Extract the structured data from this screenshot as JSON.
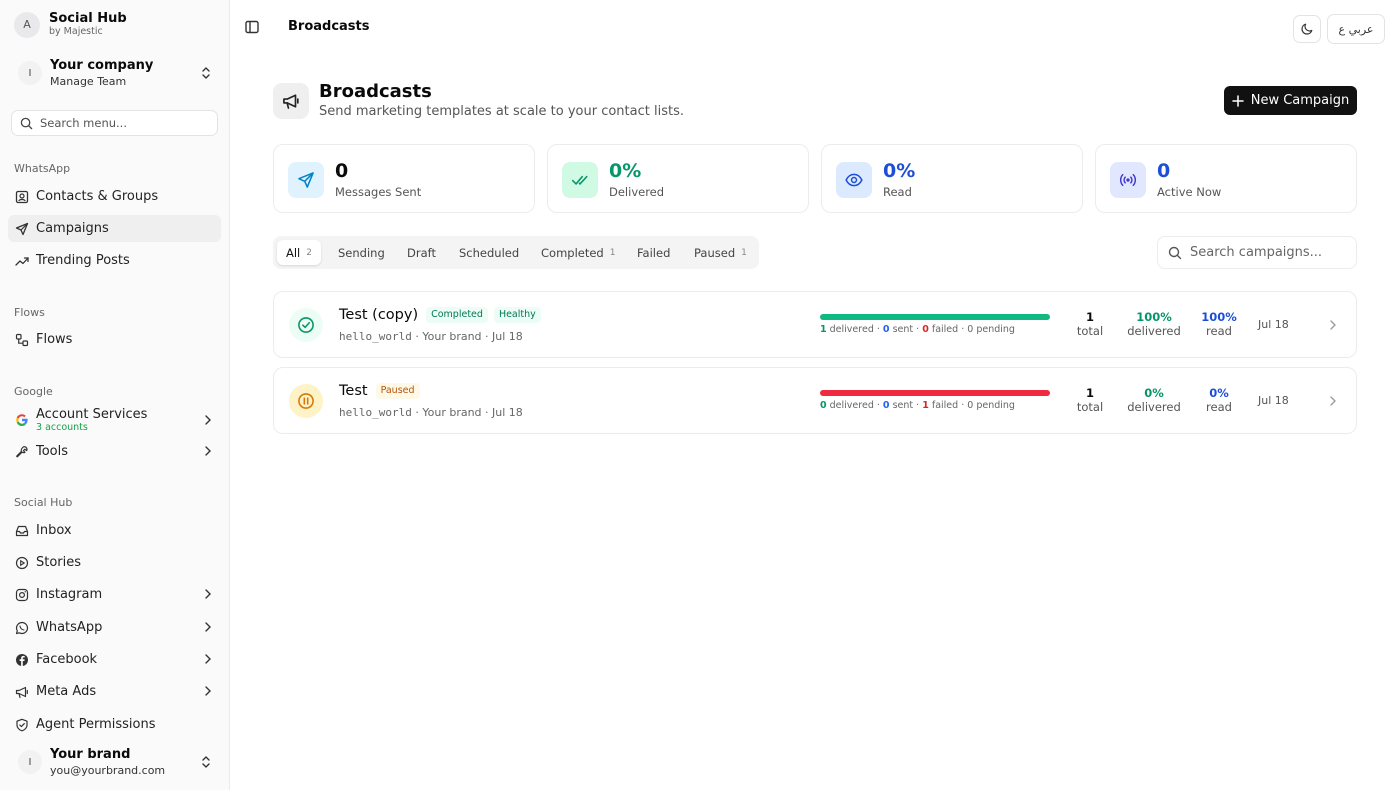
{
  "sidebar": {
    "brand": {
      "avatar": "A",
      "name": "Social Hub",
      "byline": "by Majestic"
    },
    "company": {
      "avatar": "I",
      "name": "Your company",
      "sub": "Manage Team"
    },
    "search_placeholder": "Search menu...",
    "sections": {
      "whatsapp": "WhatsApp",
      "flows": "Flows",
      "google": "Google",
      "social": "Social Hub"
    },
    "items": {
      "contacts": "Contacts & Groups",
      "campaigns": "Campaigns",
      "trending": "Trending Posts",
      "flows": "Flows",
      "account_services": "Account Services",
      "account_services_sub": "3 accounts",
      "tools": "Tools",
      "inbox": "Inbox",
      "stories": "Stories",
      "instagram": "Instagram",
      "whatsapp": "WhatsApp",
      "facebook": "Facebook",
      "meta_ads": "Meta Ads",
      "agent_permissions": "Agent Permissions"
    },
    "user": {
      "avatar": "I",
      "name": "Your brand",
      "email": "you@yourbrand.com"
    }
  },
  "topbar": {
    "title": "Broadcasts",
    "lang_label": "عربي ع"
  },
  "header": {
    "title": "Broadcasts",
    "subtitle": "Send marketing templates at scale to your contact lists.",
    "new_button": "New Campaign"
  },
  "stats": [
    {
      "value": "0",
      "label": "Messages Sent",
      "color": "#111111"
    },
    {
      "value": "0%",
      "label": "Delivered",
      "color": "#059669"
    },
    {
      "value": "0%",
      "label": "Read",
      "color": "#1d4ed8"
    },
    {
      "value": "0",
      "label": "Active Now",
      "color": "#1d4ed8"
    }
  ],
  "tabs": [
    {
      "label": "All",
      "count": "2"
    },
    {
      "label": "Sending",
      "count": ""
    },
    {
      "label": "Draft",
      "count": ""
    },
    {
      "label": "Scheduled",
      "count": ""
    },
    {
      "label": "Completed",
      "count": "1"
    },
    {
      "label": "Failed",
      "count": ""
    },
    {
      "label": "Paused",
      "count": "1"
    }
  ],
  "campaign_search_placeholder": "Search campaigns...",
  "campaigns": [
    {
      "name": "Test (copy)",
      "status": "Completed",
      "health": "Healthy",
      "template": "hello_world",
      "brand": "· Your brand",
      "date_meta": "· Jul 18",
      "progress": 1.0,
      "progress_color": "#10b981",
      "delivered": "1",
      "delivered_label": "delivered",
      "sent": "0",
      "sent_label": "sent",
      "failed": "0",
      "failed_label": "failed",
      "pending": "0",
      "pending_label": "pending",
      "total": "1",
      "total_label": "total",
      "delivered_pct": "100%",
      "delivered_pct_label": "delivered",
      "read_pct": "100%",
      "read_pct_label": "read",
      "date": "Jul 18"
    },
    {
      "name": "Test",
      "status": "Paused",
      "health": "",
      "template": "hello_world",
      "brand": "· Your brand",
      "date_meta": "· Jul 18",
      "progress": 1.0,
      "progress_color": "#ef2b3f",
      "delivered": "0",
      "delivered_label": "delivered",
      "sent": "0",
      "sent_label": "sent",
      "failed": "1",
      "failed_label": "failed",
      "pending": "0",
      "pending_label": "pending",
      "total": "1",
      "total_label": "total",
      "delivered_pct": "0%",
      "delivered_pct_label": "delivered",
      "read_pct": "0%",
      "read_pct_label": "read",
      "date": "Jul 18"
    }
  ],
  "colors": {
    "accent": "#111111",
    "green": "#059669",
    "blue": "#1d4ed8",
    "red": "#dc2626",
    "amber": "#d97706"
  }
}
